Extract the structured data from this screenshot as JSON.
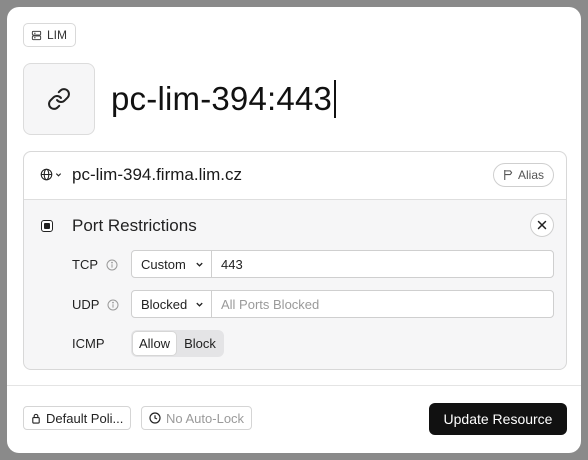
{
  "breadcrumb": {
    "label": "LIM",
    "icon": "server-icon"
  },
  "resource": {
    "title": "pc-lim-394:443",
    "icon": "link-icon"
  },
  "host": {
    "value": "pc-lim-394.firma.lim.cz",
    "selector_icon": "globe-icon",
    "alias_label": "Alias",
    "alias_icon": "signpost-icon"
  },
  "port_restrictions": {
    "title": "Port Restrictions",
    "rows": [
      {
        "label": "TCP",
        "mode": "Custom",
        "value": "443",
        "placeholder": ""
      },
      {
        "label": "UDP",
        "mode": "Blocked",
        "value": "",
        "placeholder": "All Ports Blocked"
      }
    ],
    "icmp": {
      "label": "ICMP",
      "options": [
        "Allow",
        "Block"
      ],
      "selected": "Allow"
    }
  },
  "footer": {
    "policy_label": "Default Poli...",
    "autolock_label": "No Auto-Lock",
    "submit_label": "Update Resource"
  }
}
